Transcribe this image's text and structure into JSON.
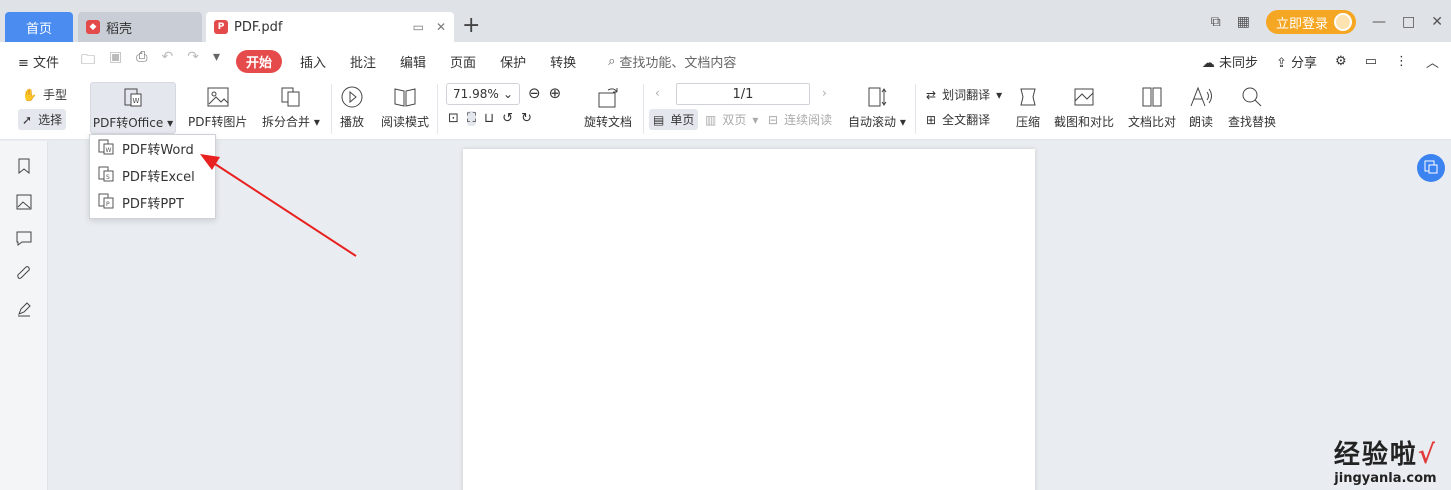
{
  "tabs": {
    "home": "首页",
    "daoke": "稻壳",
    "pdf": "PDF.pdf",
    "add": "+"
  },
  "titlebar": {
    "login": "立即登录"
  },
  "menu": {
    "file": "文件",
    "items": [
      "开始",
      "插入",
      "批注",
      "编辑",
      "页面",
      "保护",
      "转换"
    ],
    "search": "查找功能、文档内容",
    "sync": "未同步",
    "share": "分享"
  },
  "toolbar": {
    "hand": "手型",
    "select": "选择",
    "pdf_to_office": "PDF转Office",
    "pdf_to_image": "PDF转图片",
    "split_merge": "拆分合并",
    "play": "播放",
    "read_mode": "阅读模式",
    "zoom": "71.98%",
    "rotate": "旋转文档",
    "page_indicator": "1/1",
    "single": "单页",
    "double": "双页",
    "continuous": "连续阅读",
    "auto_scroll": "自动滚动",
    "word_translate": "划词翻译",
    "full_translate": "全文翻译",
    "compress": "压缩",
    "screenshot_compare": "截图和对比",
    "doc_compare": "文档比对",
    "read_aloud": "朗读",
    "find_replace": "查找替换"
  },
  "dropdown": {
    "items": [
      "PDF转Word",
      "PDF转Excel",
      "PDF转PPT"
    ]
  },
  "watermark": {
    "main": "经验啦",
    "check": "√",
    "sub": "jingyanla.com"
  },
  "colors": {
    "accent": "#4a8cf0",
    "start": "#e64b4b",
    "login": "#f5a623",
    "arrow": "#e8201f"
  }
}
